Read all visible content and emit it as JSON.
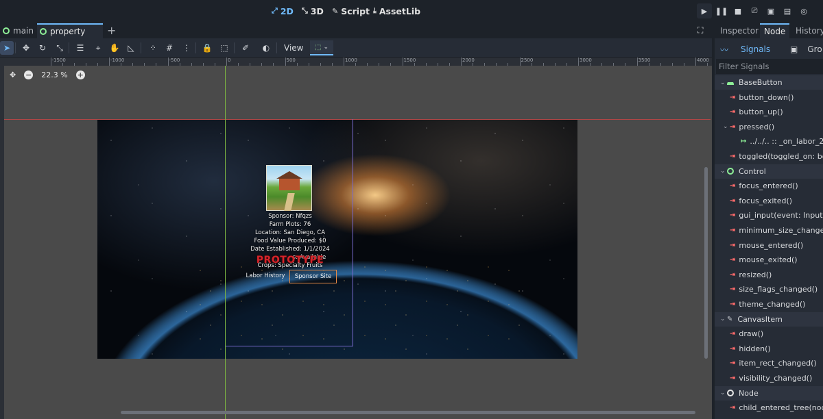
{
  "topbar": {
    "modes": [
      {
        "label": "2D",
        "icon": "2d-icon",
        "active": true
      },
      {
        "label": "3D",
        "icon": "3d-icon",
        "active": false
      },
      {
        "label": "Script",
        "icon": "script-icon",
        "active": false
      },
      {
        "label": "AssetLib",
        "icon": "assetlib-icon",
        "active": false
      }
    ],
    "run_buttons": [
      "play-icon",
      "pause-icon",
      "stop-icon",
      "remote-debug-icon",
      "play-scene-icon",
      "play-custom-icon",
      "movie-icon"
    ]
  },
  "scene_tabs": {
    "tabs": [
      {
        "label": "main",
        "active": false
      },
      {
        "label": "property",
        "active": true
      }
    ]
  },
  "toolbar": {
    "view_label": "View",
    "tools": [
      "select-icon",
      "move-icon",
      "rotate-icon",
      "scale-icon",
      "list-icon",
      "pivot-icon",
      "pan-icon",
      "ruler-icon",
      "smart-snap-icon",
      "grid-snap-icon",
      "more-icon",
      "lock-icon",
      "group-icon",
      "bone-icon",
      "light-icon"
    ]
  },
  "viewport": {
    "zoom": "22.3 %",
    "ruler_labels": [
      "-1500",
      "-1000",
      "-500",
      "0",
      "500",
      "1000",
      "1500",
      "2000",
      "2500",
      "3000",
      "3500",
      "4000"
    ],
    "property": {
      "sponsor": "Sponsor: Nfqzs",
      "farm_plots": "Farm Plots: 76",
      "location": "Location: San Diego, CA",
      "food_value": "Food Value Produced: $0",
      "date": "Date Established: 1/1/2024",
      "status_partial": "s: Available",
      "crops": "Crops: Specialty Fruits",
      "prototype": "PROTOTYPE",
      "labor_button": "Labor History",
      "sponsor_button": "Sponsor Site"
    }
  },
  "dock": {
    "tabs": [
      {
        "label": "Inspector",
        "active": false
      },
      {
        "label": "Node",
        "active": true
      },
      {
        "label": "History",
        "active": false
      }
    ],
    "signals_label": "Signals",
    "groups_label": "Gro",
    "filter_placeholder": "Filter Signals",
    "tree": [
      {
        "type": "class",
        "label": "BaseButton",
        "icon": "basebutton-icon"
      },
      {
        "type": "signal",
        "label": "button_down()"
      },
      {
        "type": "signal",
        "label": "button_up()"
      },
      {
        "type": "signal-expanded",
        "label": "pressed()"
      },
      {
        "type": "connection",
        "label": "../../.. :: _on_labor_2_p"
      },
      {
        "type": "signal",
        "label": "toggled(toggled_on: bo"
      },
      {
        "type": "class",
        "label": "Control",
        "icon": "control-icon"
      },
      {
        "type": "signal",
        "label": "focus_entered()"
      },
      {
        "type": "signal",
        "label": "focus_exited()"
      },
      {
        "type": "signal",
        "label": "gui_input(event: Input"
      },
      {
        "type": "signal",
        "label": "minimum_size_change"
      },
      {
        "type": "signal",
        "label": "mouse_entered()"
      },
      {
        "type": "signal",
        "label": "mouse_exited()"
      },
      {
        "type": "signal",
        "label": "resized()"
      },
      {
        "type": "signal",
        "label": "size_flags_changed()"
      },
      {
        "type": "signal",
        "label": "theme_changed()"
      },
      {
        "type": "class",
        "label": "CanvasItem",
        "icon": "canvasitem-icon"
      },
      {
        "type": "signal",
        "label": "draw()"
      },
      {
        "type": "signal",
        "label": "hidden()"
      },
      {
        "type": "signal",
        "label": "item_rect_changed()"
      },
      {
        "type": "signal",
        "label": "visibility_changed()"
      },
      {
        "type": "class",
        "label": "Node",
        "icon": "node-icon"
      },
      {
        "type": "signal",
        "label": "child_entered_tree(noc"
      }
    ]
  },
  "colors": {
    "accent": "#70bafa",
    "signal": "#ff6b6b",
    "node_green": "#8eef97",
    "button_border": "#e58a45",
    "prototype_red": "#d6242a"
  }
}
